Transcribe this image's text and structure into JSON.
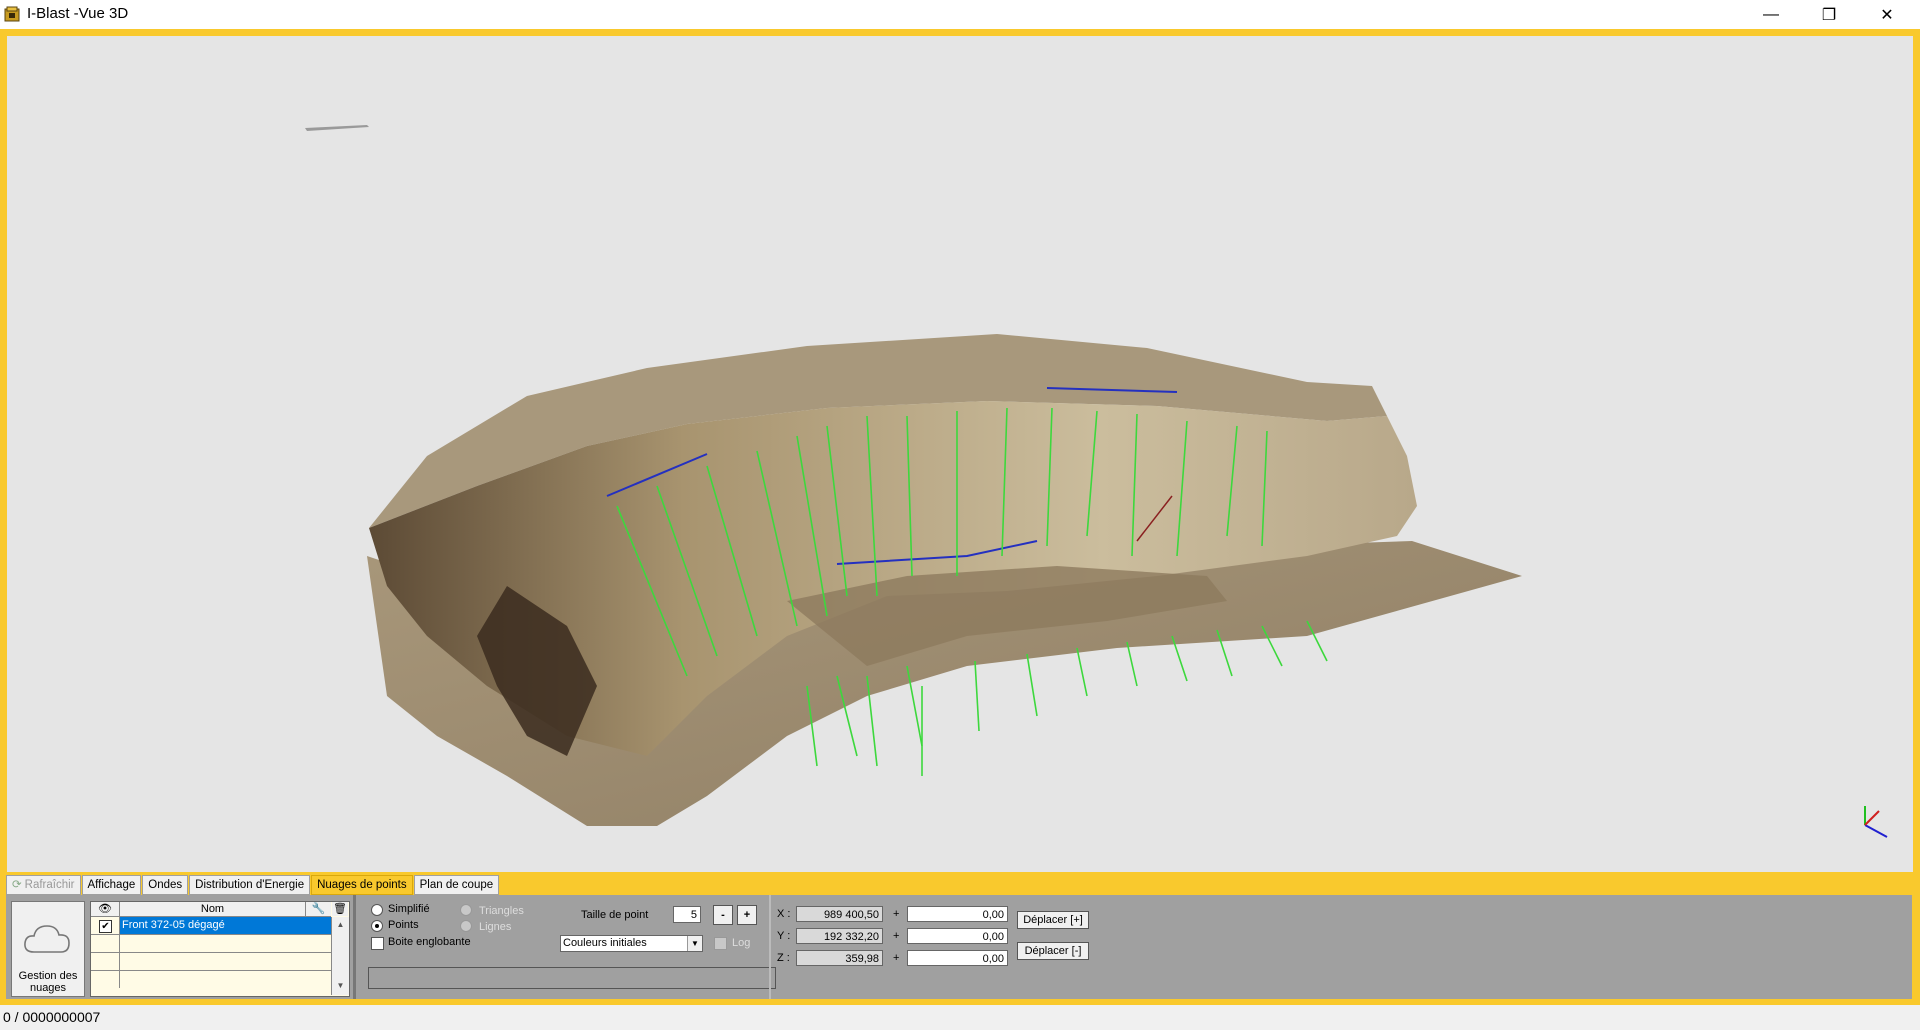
{
  "window": {
    "title": "I-Blast -Vue 3D",
    "minimize_glyph": "—",
    "restore_glyph": "❐",
    "close_glyph": "✕",
    "accent_color": "#f9c92d"
  },
  "tabs": {
    "refresh": "Rafraîchir",
    "items": [
      "Affichage",
      "Ondes",
      "Distribution d'Energie",
      "Nuages de points",
      "Plan de coupe"
    ],
    "active": "Nuages de points"
  },
  "cloud_manager": {
    "label": "Gestion des nuages",
    "icon": "cloud-icon",
    "column_visible_icon": "eye-icon",
    "column_name": "Nom",
    "column_edit_icon": "wrench-icon",
    "column_delete_icon": "trash-icon",
    "rows": [
      {
        "checked": true,
        "name": "Front 372-05 dégagé",
        "selected": true
      }
    ]
  },
  "display_options": {
    "simplified": "Simplifié",
    "points": "Points",
    "triangles": "Triangles",
    "lines": "Lignes",
    "bounding_box": "Boite englobante",
    "mode_selected": "Points",
    "point_size_label": "Taille de point",
    "point_size": "5",
    "minus": "-",
    "plus": "+",
    "color_mode": "Couleurs initiales",
    "log": "Log"
  },
  "coordinates": {
    "x_label": "X :",
    "y_label": "Y :",
    "z_label": "Z :",
    "x": "989 400,50",
    "y": "192 332,20",
    "z": "359,98",
    "plus_sign": "+",
    "dx": "0,00",
    "dy": "0,00",
    "dz": "0,00",
    "move_plus": "Déplacer [+]",
    "move_minus": "Déplacer [-]"
  },
  "status_bar": {
    "text": "0 / 0000000007"
  }
}
